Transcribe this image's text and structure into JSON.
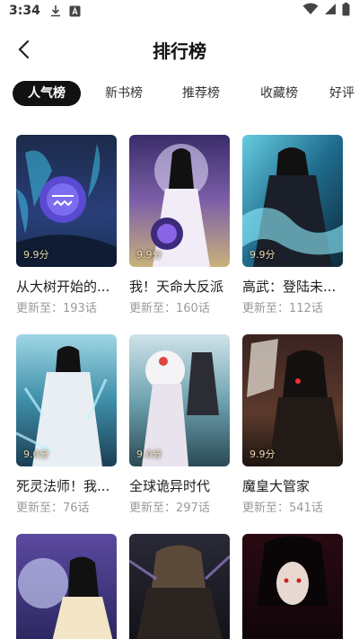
{
  "status_bar": {
    "time": "3:34"
  },
  "header": {
    "title": "排行榜"
  },
  "tabs": [
    {
      "label": "人气榜",
      "active": true
    },
    {
      "label": "新书榜",
      "active": false
    },
    {
      "label": "推荐榜",
      "active": false
    },
    {
      "label": "收藏榜",
      "active": false
    },
    {
      "label": "好评",
      "active": false
    }
  ],
  "comics": [
    {
      "title": "从大树开始的...",
      "score": "9.9分",
      "update": "更新至：193话"
    },
    {
      "title": "我！天命大反派",
      "score": "9.9分",
      "update": "更新至：160话"
    },
    {
      "title": "高武：登陆未...",
      "score": "9.9分",
      "update": "更新至：112话"
    },
    {
      "title": "死灵法师！我...",
      "score": "9.0分",
      "update": "更新至：76话"
    },
    {
      "title": "全球诡异时代",
      "score": "9.0分",
      "update": "更新至：297话"
    },
    {
      "title": "魔皇大管家",
      "score": "9.9分",
      "update": "更新至：541话"
    },
    {
      "title": "",
      "score": "",
      "update": ""
    },
    {
      "title": "",
      "score": "",
      "update": ""
    },
    {
      "title": "",
      "score": "",
      "update": ""
    }
  ]
}
